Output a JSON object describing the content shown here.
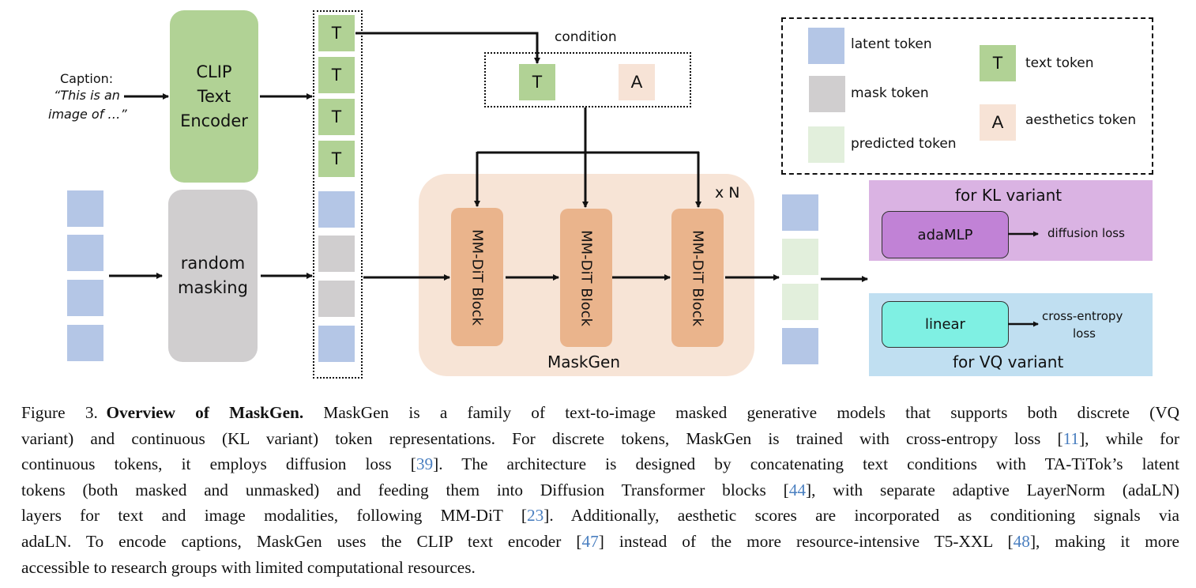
{
  "diagram": {
    "caption_input": {
      "label": "Caption:",
      "text_line1": "“This is an",
      "text_line2": "image of …”"
    },
    "clip_encoder": {
      "line1": "CLIP",
      "line2": "Text",
      "line3": "Encoder"
    },
    "random_masking": {
      "line1": "random",
      "line2": "masking"
    },
    "token_column": {
      "text_tokens": [
        "T",
        "T",
        "T",
        "T"
      ],
      "image_tokens": [
        "latent",
        "mask",
        "mask",
        "latent"
      ]
    },
    "input_tokens": [
      "latent",
      "latent",
      "latent",
      "latent"
    ],
    "condition": {
      "label": "condition",
      "text_token": "T",
      "aesthetics_token": "A"
    },
    "maskgen": {
      "label": "MaskGen",
      "repeat": "x N",
      "blocks": [
        "MM-DiT Block",
        "MM-DiT Block",
        "MM-DiT Block"
      ]
    },
    "output_tokens": [
      "latent",
      "predicted",
      "predicted",
      "latent"
    ],
    "kl_variant": {
      "title": "for KL variant",
      "head": "adaMLP",
      "loss": "diffusion loss"
    },
    "vq_variant": {
      "title": "for VQ variant",
      "head": "linear",
      "loss_line1": "cross-entropy",
      "loss_line2": "loss"
    },
    "legend": {
      "latent": "latent token",
      "mask": "mask token",
      "predicted": "predicted token",
      "text": "text token",
      "text_glyph": "T",
      "aesthetics": "aesthetics token",
      "aesthetics_glyph": "A"
    },
    "colors": {
      "latent": "#b4c6e6",
      "mask": "#d0cecf",
      "predicted": "#e2efdc",
      "text": "#b1d295",
      "aesthetics": "#f7e3d6",
      "clip": "#b1d295",
      "random_masking": "#d0cecf",
      "maskgen_bg": "#f7e4d6",
      "dit_block": "#eab48c",
      "kl_bg": "#dab3e3",
      "adamlp": "#c182d6",
      "vq_bg": "#c0dff1",
      "linear": "#7ff0e3",
      "citation": "#4a7fc0"
    }
  },
  "caption": {
    "figure_label": "Figure 3.",
    "title": "Overview of MaskGen.",
    "lines": [
      [
        {
          "t": " MaskGen is a family of text-to-image masked generative models that supports both discrete (VQ"
        }
      ],
      [
        {
          "t": "variant) and continuous (KL variant) token representations. For discrete tokens, MaskGen is trained with cross-entropy loss ["
        },
        {
          "c": "11"
        },
        {
          "t": "], while for"
        }
      ],
      [
        {
          "t": "continuous tokens, it employs diffusion loss ["
        },
        {
          "c": "39"
        },
        {
          "t": "]. The architecture is designed by concatenating text conditions with TA-TiTok’s latent"
        }
      ],
      [
        {
          "t": "tokens (both masked and unmasked) and feeding them into Diffusion Transformer blocks ["
        },
        {
          "c": "44"
        },
        {
          "t": "], with separate adaptive LayerNorm (adaLN)"
        }
      ],
      [
        {
          "t": "layers for text and image modalities, following MM-DiT ["
        },
        {
          "c": "23"
        },
        {
          "t": "]. Additionally, aesthetic scores are incorporated as conditioning signals via"
        }
      ],
      [
        {
          "t": "adaLN. To encode captions, MaskGen uses the CLIP text encoder ["
        },
        {
          "c": "47"
        },
        {
          "t": "] instead of the more resource-intensive T5-XXL ["
        },
        {
          "c": "48"
        },
        {
          "t": "], making it more"
        }
      ],
      [
        {
          "t": "accessible to research groups with limited computational resources."
        }
      ]
    ]
  }
}
